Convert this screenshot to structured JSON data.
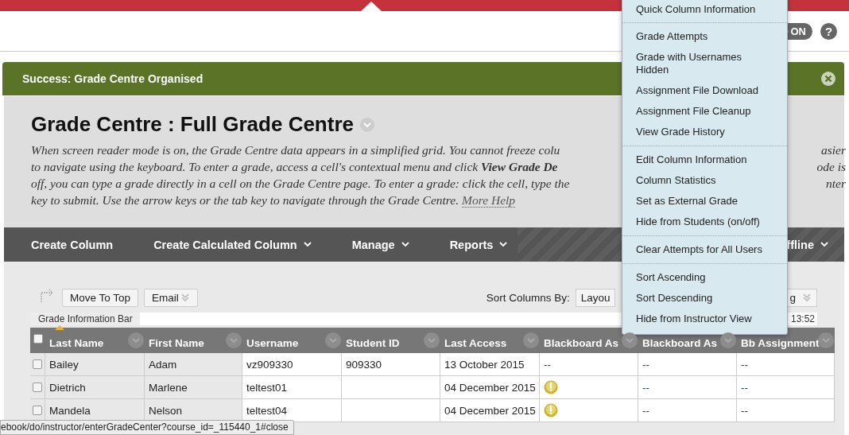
{
  "header": {
    "toggle": {
      "label": "ON",
      "on": true
    },
    "help": "?"
  },
  "success": {
    "message": "Success: Grade Centre Organised"
  },
  "page": {
    "title": "Grade Centre : Full Grade Centre",
    "lines": [
      {
        "text": "When screen reader mode is on, the Grade Centre data appears in a simplified grid. You cannot freeze colu",
        "right": "asier"
      },
      {
        "text": "to navigate using the keyboard. To enter a grade, access a cell's contextual menu and click **View Grade De**",
        "right": "ode is"
      },
      {
        "text": "off, you can type a grade directly in a cell on the Grade Centre page. To enter a grade: click the cell, type the",
        "right": "nter"
      },
      {
        "text": "key to submit. Use the arrow keys or the tab key to navigate through the Grade Centre.",
        "link": "More Help"
      }
    ]
  },
  "toolbar": {
    "items": [
      {
        "label": "Create Column",
        "dropdown": false
      },
      {
        "label": "Create Calculated Column",
        "dropdown": true
      },
      {
        "label": "Manage",
        "dropdown": true
      },
      {
        "label": "Reports",
        "dropdown": true
      }
    ],
    "right": {
      "label": "ffline",
      "dropdown": true
    }
  },
  "actions": {
    "buttons": [
      {
        "label": "Move To Top",
        "dropdown": false
      },
      {
        "label": "Email",
        "dropdown": true
      }
    ],
    "sort_label": "Sort Columns By:",
    "sort_value": "Layou",
    "order_value": "g"
  },
  "info_bar": {
    "label": "Grade Information Bar",
    "time": "13:52"
  },
  "table": {
    "all_checked": false,
    "columns": [
      {
        "label": "Last Name",
        "sorted": true
      },
      {
        "label": "First Name",
        "sorted": false
      },
      {
        "label": "Username",
        "sorted": false
      },
      {
        "label": "Student ID",
        "sorted": false
      },
      {
        "label": "Last Access",
        "sorted": false
      },
      {
        "label": "Blackboard As",
        "sorted": false
      },
      {
        "label": "Blackboard As",
        "sorted": false
      },
      {
        "label": "Bb Assignment",
        "sorted": false
      }
    ],
    "rows": [
      {
        "checked": false,
        "cells": [
          {
            "kind": "text",
            "text": "Bailey"
          },
          {
            "kind": "text",
            "text": "Adam"
          },
          {
            "kind": "text",
            "text": "vz909330"
          },
          {
            "kind": "text",
            "text": "909330"
          },
          {
            "kind": "text",
            "text": "13 October 2015"
          },
          {
            "kind": "grade",
            "text": "--"
          },
          {
            "kind": "grade",
            "text": "--"
          },
          {
            "kind": "grade",
            "text": "--"
          }
        ]
      },
      {
        "checked": false,
        "cells": [
          {
            "kind": "text",
            "text": "Dietrich"
          },
          {
            "kind": "text",
            "text": "Marlene"
          },
          {
            "kind": "text",
            "text": "teltest01"
          },
          {
            "kind": "text",
            "text": ""
          },
          {
            "kind": "text",
            "text": "04 December 2015"
          },
          {
            "kind": "attempt"
          },
          {
            "kind": "grade",
            "text": "--"
          },
          {
            "kind": "grade",
            "text": "--"
          }
        ]
      },
      {
        "checked": false,
        "cells": [
          {
            "kind": "text",
            "text": "Mandela"
          },
          {
            "kind": "text",
            "text": "Nelson"
          },
          {
            "kind": "text",
            "text": "teltest04"
          },
          {
            "kind": "text",
            "text": ""
          },
          {
            "kind": "text",
            "text": "04 December 2015"
          },
          {
            "kind": "attempt"
          },
          {
            "kind": "grade",
            "text": "--"
          },
          {
            "kind": "grade",
            "text": "--"
          }
        ]
      }
    ]
  },
  "menu": {
    "groups": [
      {
        "items": [
          "Quick Column Information"
        ]
      },
      {
        "items": [
          "Grade Attempts",
          "Grade with Usernames Hidden",
          "Assignment File Download",
          "Assignment File Cleanup",
          "View Grade History"
        ]
      },
      {
        "items": [
          "Edit Column Information",
          "Column Statistics",
          "Set as External Grade",
          "Hide from Students (on/off)"
        ]
      },
      {
        "items": [
          "Clear Attempts for All Users"
        ]
      },
      {
        "items": [
          "Sort Ascending",
          "Sort Descending",
          "Hide from Instructor View"
        ]
      }
    ]
  },
  "status_url": "ebook/do/instructor/enterGradeCenter?course_id=_115440_1#close"
}
